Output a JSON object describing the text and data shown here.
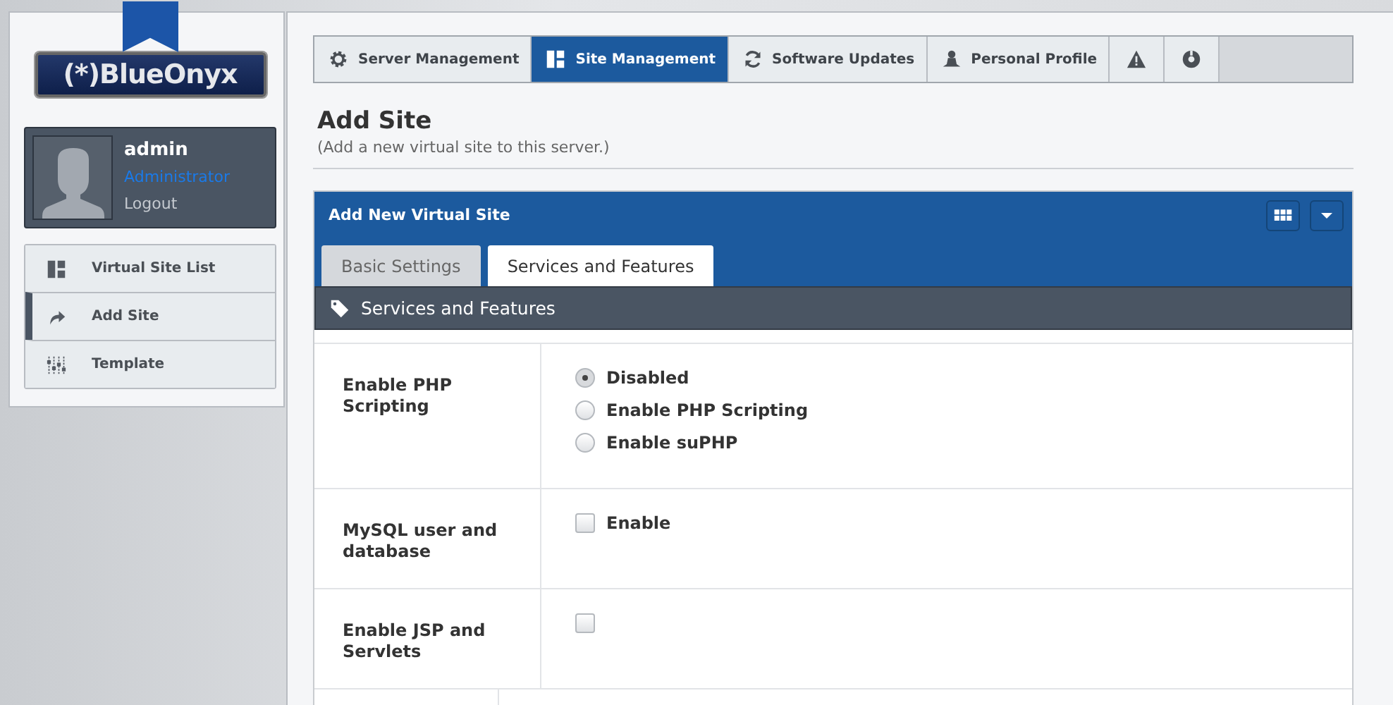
{
  "logo": {
    "text": "(*)BlueOnyx"
  },
  "user": {
    "name": "admin",
    "role": "Administrator",
    "logout": "Logout"
  },
  "sidebar": {
    "items": [
      {
        "label": "Virtual Site List",
        "selected": false
      },
      {
        "label": "Add Site",
        "selected": true
      },
      {
        "label": "Template",
        "selected": false
      }
    ]
  },
  "nav": {
    "items": [
      {
        "label": "Server Management",
        "selected": false
      },
      {
        "label": "Site Management",
        "selected": true
      },
      {
        "label": "Software Updates",
        "selected": false
      },
      {
        "label": "Personal Profile",
        "selected": false
      },
      {
        "selected": false
      },
      {
        "selected": false
      }
    ]
  },
  "page": {
    "title": "Add Site",
    "subtitle": "(Add a new virtual site to this server.)"
  },
  "panel": {
    "title": "Add New Virtual Site",
    "tabs": [
      {
        "label": "Basic Settings",
        "selected": false
      },
      {
        "label": "Services and Features",
        "selected": true
      }
    ],
    "section": "Services and Features",
    "rows": [
      {
        "label": "Enable PHP Scripting",
        "kind": "radio",
        "options": [
          {
            "label": "Disabled",
            "selected": true
          },
          {
            "label": "Enable PHP Scripting",
            "selected": false
          },
          {
            "label": "Enable suPHP",
            "selected": false
          }
        ]
      },
      {
        "label": "MySQL user and database",
        "kind": "checkbox",
        "options": [
          {
            "label": "Enable",
            "checked": false
          }
        ]
      },
      {
        "label": "Enable JSP and Servlets",
        "kind": "checkbox",
        "options": [
          {
            "checked": false
          }
        ]
      }
    ]
  }
}
